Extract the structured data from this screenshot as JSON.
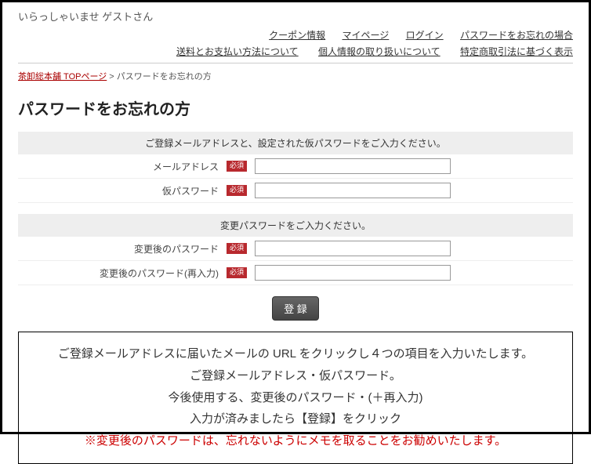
{
  "greeting": "いらっしゃいませ  ゲストさん",
  "nav1": {
    "coupon": "クーポン情報",
    "mypage": "マイページ",
    "login": "ログイン",
    "forgot": "パスワードをお忘れの場合"
  },
  "nav2": {
    "shipping": "送料とお支払い方法について",
    "privacy": "個人情報の取り扱いについて",
    "law": "特定商取引法に基づく表示"
  },
  "breadcrumb": {
    "top": "茶卸総本舗 TOPページ",
    "sep": " > ",
    "current": "パスワードをお忘れの方"
  },
  "title": "パスワードをお忘れの方",
  "section1": {
    "header": "ご登録メールアドレスと、設定された仮パスワードをご入力ください。",
    "email_label": "メールアドレス",
    "temp_pw_label": "仮パスワード"
  },
  "section2": {
    "header": "変更パスワードをご入力ください。",
    "new_pw_label": "変更後のパスワード",
    "new_pw_confirm_label": "変更後のパスワード(再入力)"
  },
  "required_badge": "必須",
  "submit_label": "登 録",
  "info": {
    "line1": "ご登録メールアドレスに届いたメールの URL をクリックし４つの項目を入力いたします。",
    "line2": "ご登録メールアドレス・仮パスワード。",
    "line3": "今後使用する、変更後のパスワード・(＋再入力)",
    "line4": "入力が済みましたら【登録】をクリック",
    "line5": "※変更後のパスワードは、忘れないようにメモを取ることをお勧めいたします。"
  }
}
